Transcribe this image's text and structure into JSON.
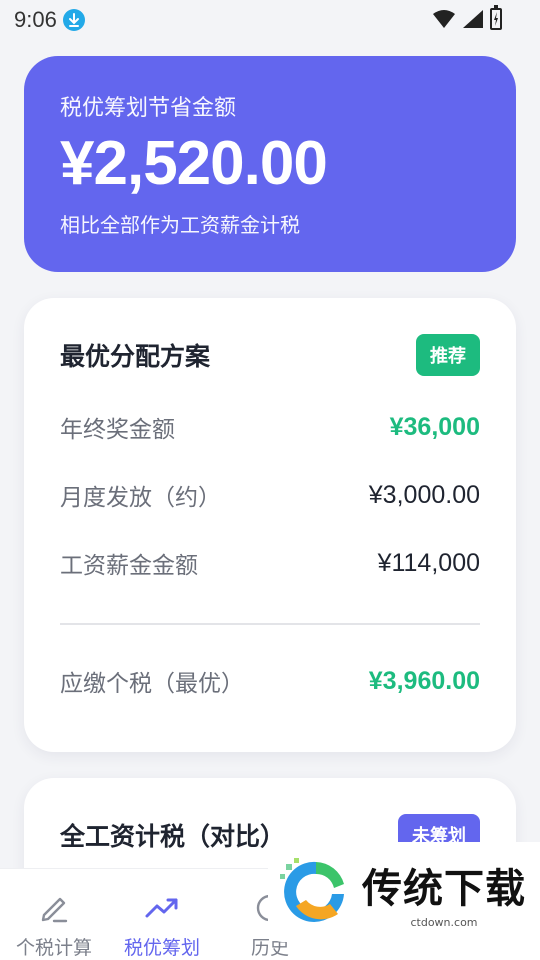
{
  "status_bar": {
    "time": "9:06",
    "icons": [
      "download-icon",
      "wifi-icon",
      "signal-icon",
      "battery-icon"
    ]
  },
  "hero": {
    "title": "税优筹划节省金额",
    "amount": "¥2,520.00",
    "subtitle": "相比全部作为工资薪金计税",
    "color": "#6366ee"
  },
  "optimal_plan": {
    "title": "最优分配方案",
    "badge": "推荐",
    "rows": [
      {
        "label": "年终奖金额",
        "value": "¥36,000"
      },
      {
        "label": "月度发放（约）",
        "value": "¥3,000.00"
      },
      {
        "label": "工资薪金金额",
        "value": "¥114,000"
      }
    ],
    "total": {
      "label": "应缴个税（最优）",
      "value": "¥3,960.00"
    }
  },
  "compare_plan": {
    "title": "全工资计税（对比）",
    "badge": "未筹划"
  },
  "bottom_nav": [
    {
      "label": "个税计算",
      "icon": "pencil-icon",
      "active": false
    },
    {
      "label": "税优筹划",
      "icon": "trend-up-icon",
      "active": true
    },
    {
      "label": "历史",
      "icon": "history-icon",
      "active": false
    }
  ],
  "watermark": {
    "text": "传统下载",
    "url": "ctdown.com"
  },
  "colors": {
    "accent": "#6366ee",
    "positive": "#1dbb7f",
    "background": "#f3f4f7"
  }
}
